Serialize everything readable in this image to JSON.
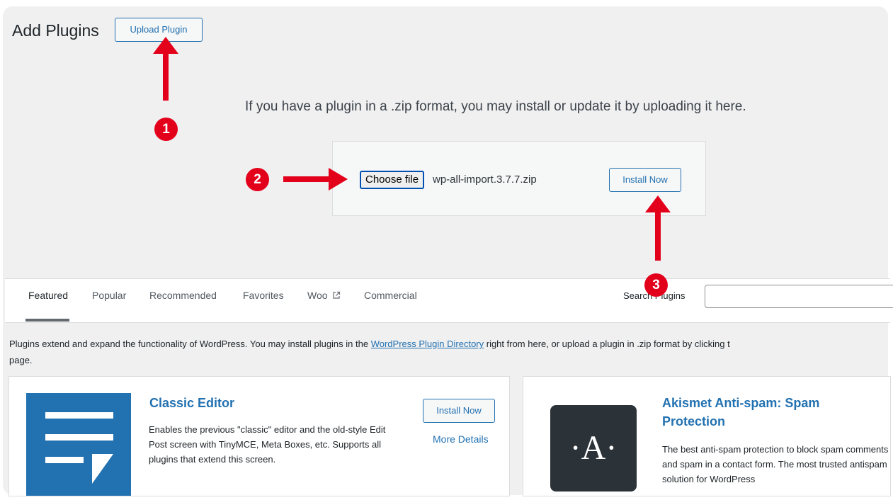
{
  "header": {
    "title": "Add Plugins",
    "upload_button": "Upload Plugin"
  },
  "upload": {
    "description": "If you have a plugin in a .zip format, you may install or update it by uploading it here.",
    "choose_file": "Choose file",
    "file_name": "wp-all-import.3.7.7.zip",
    "install_button": "Install Now"
  },
  "tabs": [
    {
      "label": "Featured",
      "current": true
    },
    {
      "label": "Popular"
    },
    {
      "label": "Recommended"
    },
    {
      "label": "Favorites"
    },
    {
      "label": "Woo",
      "icon": "external-link-icon"
    },
    {
      "label": "Commercial"
    }
  ],
  "search": {
    "label": "Search Plugins",
    "value": ""
  },
  "intro": {
    "before": "Plugins extend and expand the functionality of WordPress. You may install plugins in the ",
    "link": "WordPress Plugin Directory",
    "after": " right from here, or upload a plugin in .zip format by clicking t",
    "line2": "page."
  },
  "cards": [
    {
      "title": "Classic Editor",
      "description": "Enables the previous \"classic\" editor and the old-style Edit Post screen with TinyMCE, Meta Boxes, etc. Supports all plugins that extend this screen.",
      "install": "Install Now",
      "more": "More Details",
      "icon": "classic-editor-icon"
    },
    {
      "title": "Akismet Anti-spam: Spam Protection",
      "description": "The best anti-spam protection to block spam comments and spam in a contact form. The most trusted antispam solution for WordPress",
      "icon_text": "·A·",
      "icon": "akismet-icon"
    }
  ],
  "annotations": {
    "step1": "1",
    "step2": "2",
    "step3": "3",
    "color": "#e3001b"
  }
}
